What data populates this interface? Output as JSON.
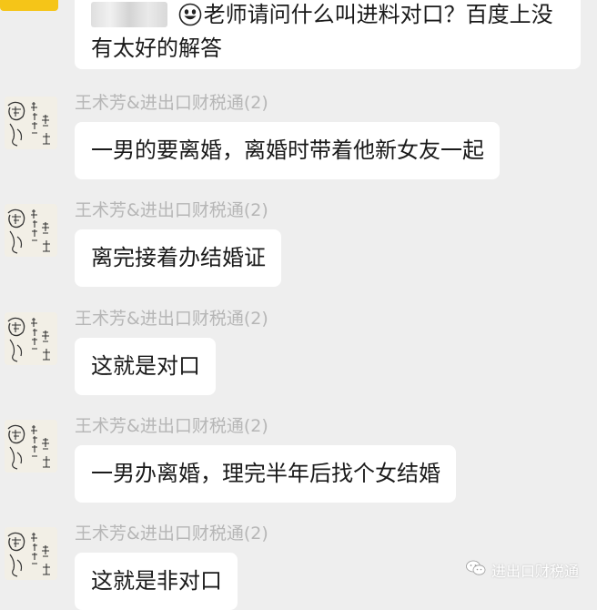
{
  "chat": {
    "top_message": {
      "mention": "",
      "text": "老师请问什么叫进料对口？百度上没有太好的解答"
    },
    "messages": [
      {
        "sender": "王术芳&进出口财税通(2)",
        "text": "一男的要离婚，离婚时带着他新女友一起"
      },
      {
        "sender": "王术芳&进出口财税通(2)",
        "text": "离完接着办结婚证"
      },
      {
        "sender": "王术芳&进出口财税通(2)",
        "text": "这就是对口"
      },
      {
        "sender": "王术芳&进出口财税通(2)",
        "text": "一男办离婚，理完半年后找个女结婚"
      },
      {
        "sender": "王术芳&进出口财税通(2)",
        "text": "这就是非对口"
      }
    ]
  },
  "watermark": {
    "label": "进出口财税通",
    "icon": "wechat-icon"
  },
  "colors": {
    "background": "#eeeeee",
    "bubble": "#ffffff",
    "sender_text": "#b6b6b6",
    "top_avatar": "#f5c518"
  }
}
